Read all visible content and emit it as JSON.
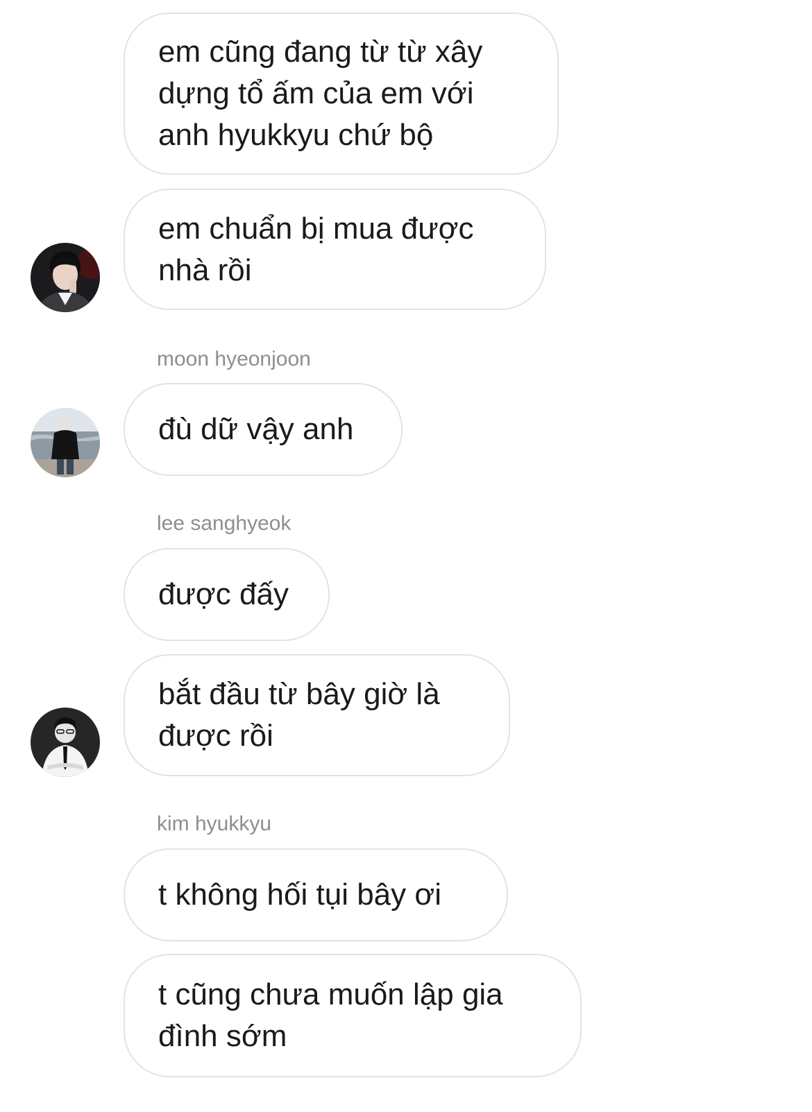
{
  "chat": {
    "messages": [
      {
        "text": "em cũng đang từ từ xây\ndựng tổ ấm của em với\nanh hyukkyu chứ bộ"
      },
      {
        "text": "em chuẩn bị mua được\nnhà rồi"
      },
      {
        "sender": "moon hyeonjoon",
        "text": "đù dữ vậy anh"
      },
      {
        "sender": "lee sanghyeok",
        "text": "được đấy"
      },
      {
        "text": "bắt đầu từ bây giờ là\nđược rồi"
      },
      {
        "sender": "kim hyukkyu",
        "text": "t không hối tụi bây ơi"
      },
      {
        "text": "t cũng chưa muốn lập gia\nđình sớm"
      }
    ],
    "avatars": [
      {
        "icon": "avatar-portrait-dark-icon"
      },
      {
        "icon": "avatar-seaside-icon"
      },
      {
        "icon": "avatar-suit-bw-icon"
      }
    ]
  },
  "colors": {
    "bubble_border": "#e3e3e3",
    "message_text": "#1a1a1a",
    "sender_text": "#8e8e8e",
    "background": "#ffffff"
  }
}
